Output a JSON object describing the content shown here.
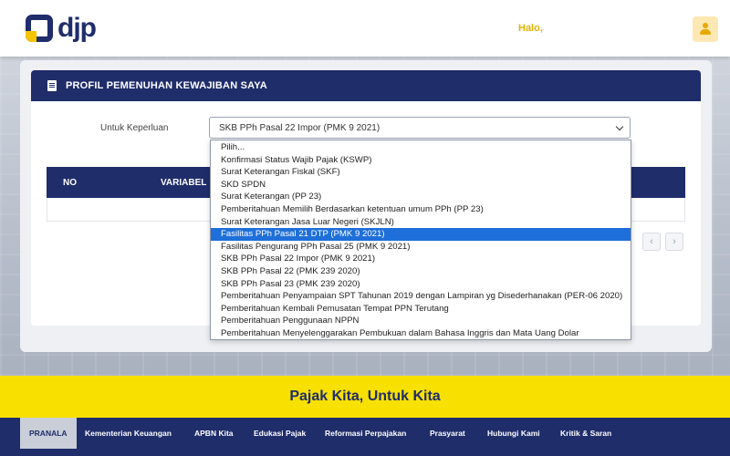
{
  "header": {
    "logo_text": "djp",
    "greeting": "Halo,",
    "user_icon": "user-icon"
  },
  "profile": {
    "title": "PROFIL PEMENUHAN KEWAJIBAN SAYA",
    "purpose_label": "Untuk Keperluan",
    "selected_value": "SKB PPh Pasal 22 Impor (PMK 9 2021)",
    "table": {
      "columns": [
        "NO",
        "VARIABEL"
      ]
    }
  },
  "dropdown": {
    "options": [
      "Pilih...",
      "Konfirmasi Status Wajib Pajak (KSWP)",
      "Surat Keterangan Fiskal (SKF)",
      "SKD SPDN",
      "Surat Keterangan (PP 23)",
      "Pemberitahuan Memilih Berdasarkan ketentuan umum PPh (PP 23)",
      "Surat Keterangan Jasa Luar Negeri (SKJLN)",
      "Fasilitas PPh Pasal 21 DTP (PMK 9 2021)",
      "Fasilitas Pengurang PPh Pasal 25 (PMK 9 2021)",
      "SKB PPh Pasal 22 Impor (PMK 9 2021)",
      "SKB PPh Pasal 22 (PMK 239 2020)",
      "SKB PPh Pasal 23 (PMK 239 2020)",
      "Pemberitahuan Penyampaian SPT Tahunan 2019 dengan Lampiran yg Disederhanakan (PER-06 2020)",
      "Pemberitahuan Kembali Pemusatan Tempat PPN Terutang",
      "Pemberitahuan Penggunaan NPPN",
      "Pemberitahuan Menyelenggarakan Pembukuan dalam Bahasa Inggris dan Mata Uang Dolar"
    ],
    "highlighted": "Fasilitas PPh Pasal 21 DTP (PMK 9 2021)"
  },
  "banner": {
    "tagline": "Pajak Kita, Untuk Kita"
  },
  "footer": {
    "nav": [
      "PRANALA",
      "Kementerian Keuangan",
      "APBN Kita",
      "Edukasi Pajak",
      "Reformasi Perpajakan",
      "Prasyarat",
      "Hubungi Kami",
      "Kritik & Saran"
    ],
    "active": "PRANALA"
  },
  "colors": {
    "brand_navy": "#1f2d6b",
    "brand_yellow": "#f8e000",
    "highlight_blue": "#1e6fd9"
  }
}
